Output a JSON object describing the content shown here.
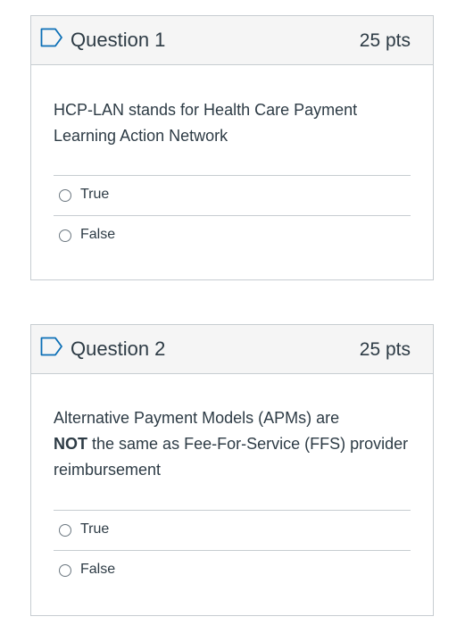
{
  "questions": [
    {
      "title": "Question 1",
      "points": "25 pts",
      "text": "HCP-LAN stands for Health Care Payment Learning Action Network",
      "answers": [
        "True",
        "False"
      ]
    },
    {
      "title": "Question 2",
      "points": "25 pts",
      "text_parts": {
        "part1": "Alternative Payment Models (APMs) are",
        "strong": "NOT",
        "part2": "the same as Fee-For-Service (FFS) provider reimbursement"
      },
      "answers": [
        "True",
        "False"
      ]
    }
  ],
  "colors": {
    "header_bg": "#f5f5f5",
    "border": "#c7cdd1",
    "text": "#2d3b45",
    "flag_stroke": "#0b6fb6"
  },
  "icons": {
    "flag": "flag-icon",
    "radio": "radio-icon"
  }
}
